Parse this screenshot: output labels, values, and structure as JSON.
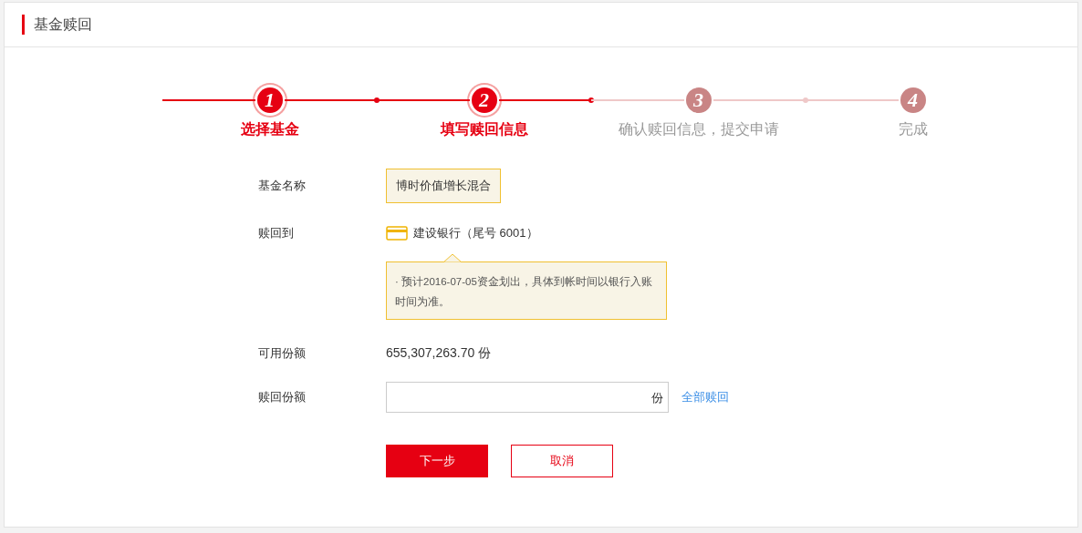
{
  "page_title": "基金赎回",
  "steps": [
    {
      "number": "1",
      "label": "选择基金",
      "active": true
    },
    {
      "number": "2",
      "label": "填写赎回信息",
      "active": true
    },
    {
      "number": "3",
      "label": "确认赎回信息，提交申请",
      "active": false
    },
    {
      "number": "4",
      "label": "完成",
      "active": false
    }
  ],
  "form": {
    "fund_name_label": "基金名称",
    "fund_name": "博时价值增长混合",
    "redeem_to_label": "赎回到",
    "bank": "建设银行（尾号 6001）",
    "notice": "· 预计2016-07-05资金划出，具体到帐时间以银行入账时间为准。",
    "available_label": "可用份额",
    "available": "655,307,263.70 份",
    "amount_label": "赎回份额",
    "amount_unit": "份",
    "redeem_all": "全部赎回"
  },
  "buttons": {
    "next": "下一步",
    "cancel": "取消"
  }
}
